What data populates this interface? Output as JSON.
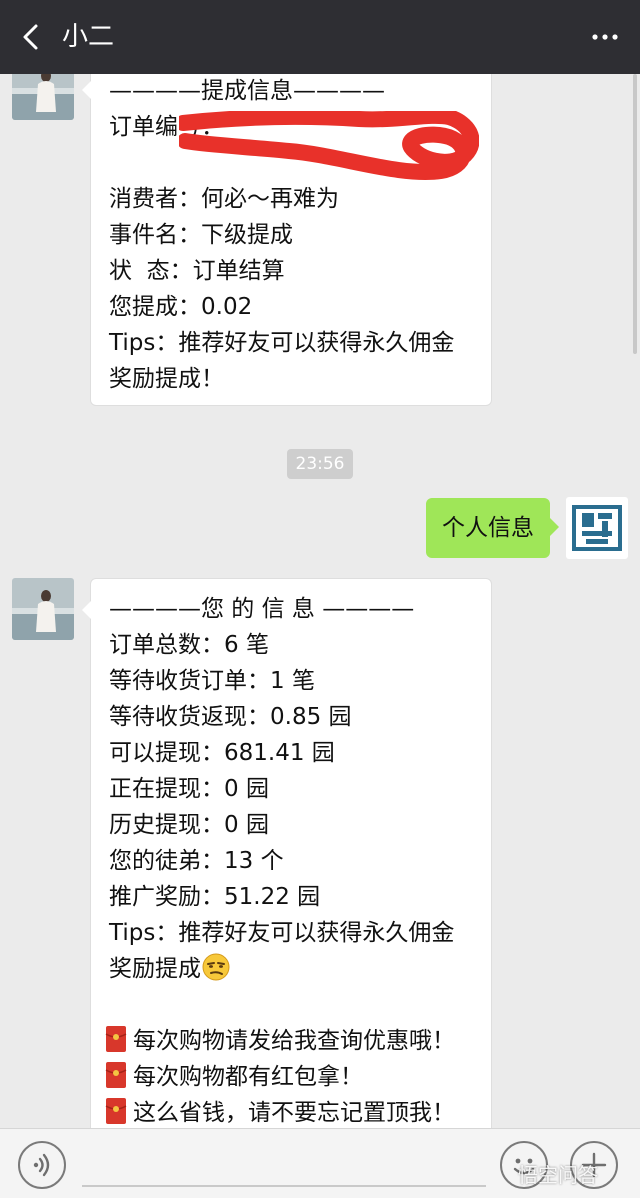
{
  "header": {
    "title": "小二"
  },
  "messages": {
    "first": {
      "lines": [
        "————提成信息————",
        "订单编号：",
        "消费者：何必～再难为",
        "事件名：下级提成",
        "状  态：订单结算",
        "您提成：0.02",
        "Tips：推荐好友可以获得永久佣金奖励提成！"
      ]
    },
    "timestamp": "23:56",
    "sent": {
      "text": "个人信息"
    },
    "second": {
      "lines": [
        "————您 的 信 息 ————",
        "订单总数：6 笔",
        "等待收货订单：1 笔",
        "等待收货返现：0.85 园",
        "可以提现：681.41 园",
        "正在提现：0 园",
        "历史提现：0 园",
        "您的徒弟：13 个",
        "推广奖励：51.22 园",
        "Tips：推荐好友可以获得永久佣金奖励提成"
      ],
      "bullets": [
        "每次购物请发给我查询优惠哦！",
        "每次购物都有红包拿！",
        "这么省钱，请不要忘记置顶我！"
      ]
    }
  },
  "watermark": "悟空问答",
  "icons": {
    "back": "chevron-left-icon",
    "more": "more-dots-icon",
    "voice": "voice-icon",
    "emoji": "emoji-icon",
    "plus": "plus-icon",
    "face": "smirk-emoji-icon",
    "envelope": "red-envelope-icon"
  },
  "colors": {
    "topbar": "#2e2e33",
    "chat_bg": "#ebebeb",
    "sent_bubble": "#9fe658",
    "redaction": "#e8312a"
  }
}
